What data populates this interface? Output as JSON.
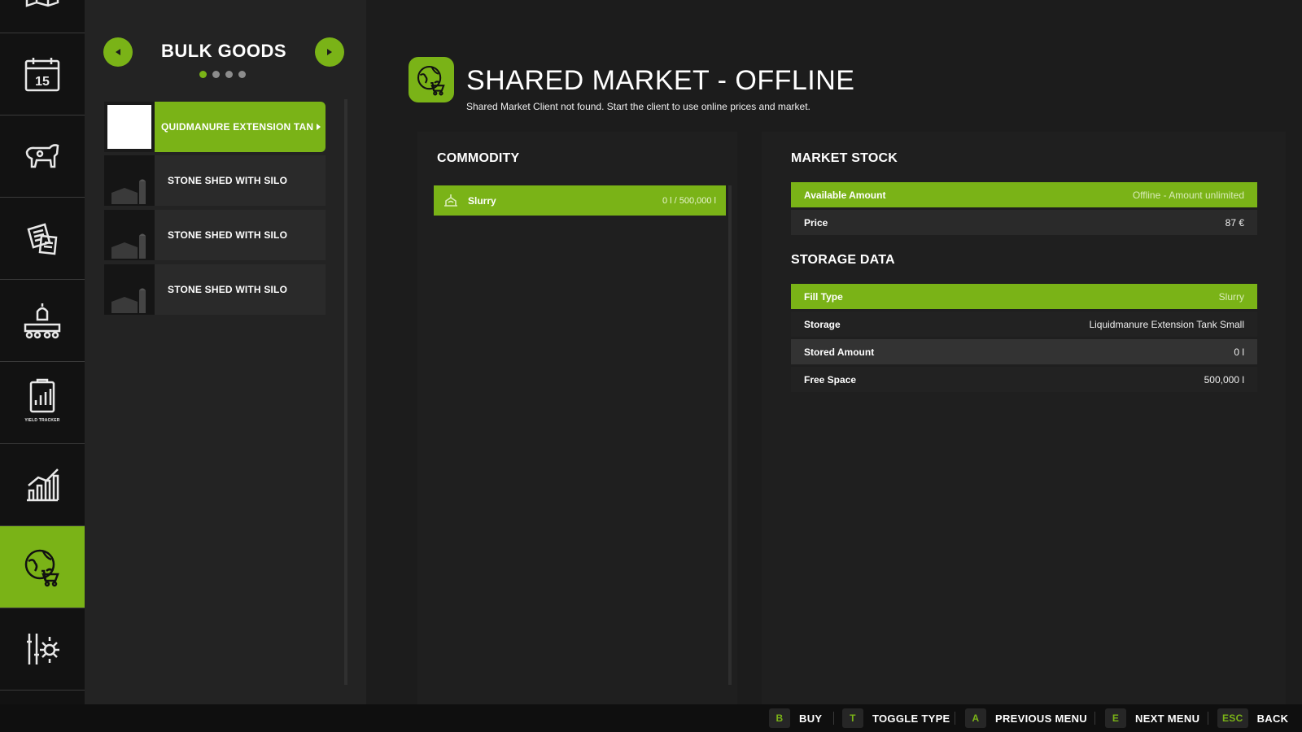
{
  "nav": {
    "items": [
      {
        "name": "map",
        "icon": "map-icon",
        "active": false
      },
      {
        "name": "calendar",
        "icon": "calendar-icon",
        "calendar_day": "15",
        "active": false
      },
      {
        "name": "animals",
        "icon": "cow-icon",
        "active": false
      },
      {
        "name": "contracts",
        "icon": "contracts-icon",
        "active": false
      },
      {
        "name": "production",
        "icon": "production-icon",
        "active": false
      },
      {
        "name": "yield-tracker",
        "icon": "yield-tracker-icon",
        "label": "YIELD TRACKER",
        "active": false
      },
      {
        "name": "statistics",
        "icon": "statistics-icon",
        "active": false
      },
      {
        "name": "shared-market",
        "icon": "globe-cart-icon",
        "active": true
      },
      {
        "name": "settings",
        "icon": "settings-icon",
        "active": false
      }
    ]
  },
  "list": {
    "title": "BULK GOODS",
    "page_count": 4,
    "current_page": 1,
    "items": [
      {
        "label": "QUIDMANURE EXTENSION TAN",
        "selected": true
      },
      {
        "label": "STONE SHED WITH SILO",
        "selected": false
      },
      {
        "label": "STONE SHED WITH SILO",
        "selected": false
      },
      {
        "label": "STONE SHED WITH SILO",
        "selected": false
      }
    ]
  },
  "header": {
    "icon": "globe-cart-icon",
    "title": "SHARED MARKET - OFFLINE",
    "subtitle": "Shared Market Client not found. Start the client to use online prices and market."
  },
  "commodity": {
    "title": "COMMODITY",
    "rows": [
      {
        "icon": "slurry-icon",
        "name": "Slurry",
        "value": "0 l / 500,000 l"
      }
    ]
  },
  "market_stock": {
    "title": "MARKET STOCK",
    "rows": [
      {
        "key": "Available Amount",
        "value": "Offline - Amount unlimited"
      },
      {
        "key": "Price",
        "value": "87 €"
      }
    ]
  },
  "storage_data": {
    "title": "STORAGE DATA",
    "rows": [
      {
        "key": "Fill Type",
        "value": "Slurry"
      },
      {
        "key": "Storage",
        "value": "Liquidmanure Extension Tank Small"
      },
      {
        "key": "Stored Amount",
        "value": "0 l"
      },
      {
        "key": "Free Space",
        "value": "500,000 l"
      }
    ]
  },
  "hints": [
    {
      "key": "B",
      "label": "BUY"
    },
    {
      "key": "T",
      "label": "TOGGLE TYPE"
    },
    {
      "key": "A",
      "label": "PREVIOUS MENU"
    },
    {
      "key": "E",
      "label": "NEXT MENU"
    },
    {
      "key": "ESC",
      "label": "BACK"
    }
  ],
  "colors": {
    "accent": "#7ab317",
    "background": "#1c1c1c",
    "rail": "#121212",
    "panel": "#1f1f1f"
  }
}
